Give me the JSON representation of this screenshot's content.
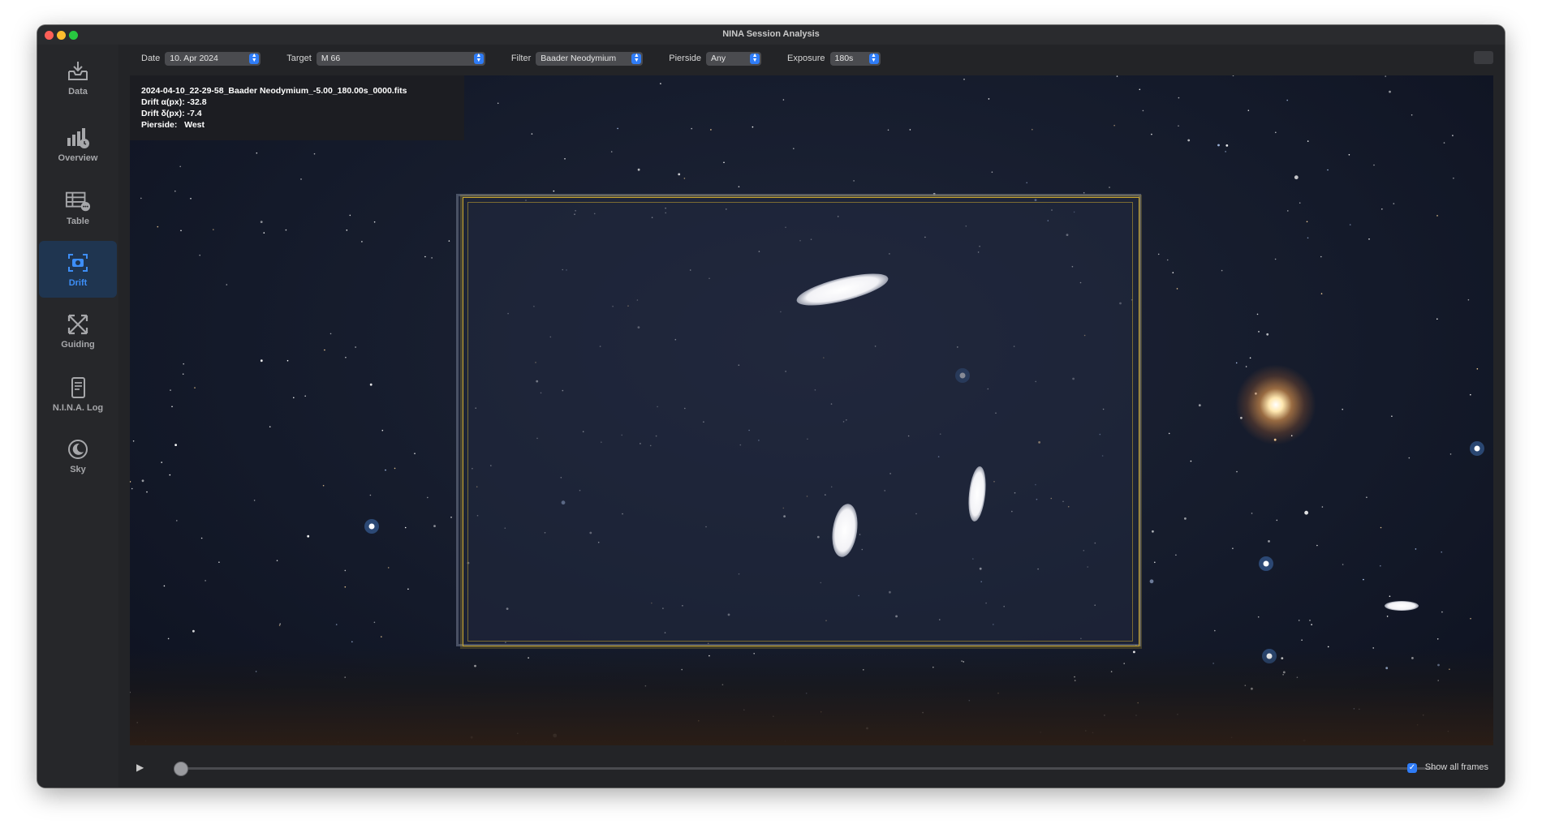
{
  "window": {
    "title": "NINA Session Analysis"
  },
  "sidebar": {
    "items": [
      {
        "label": "Data",
        "icon": "tray-download-icon",
        "active": false
      },
      {
        "label": "Overview",
        "icon": "bar-chart-icon",
        "active": false
      },
      {
        "label": "Table",
        "icon": "table-icon",
        "active": false
      },
      {
        "label": "Drift",
        "icon": "camera-viewfinder-icon",
        "active": true
      },
      {
        "label": "Guiding",
        "icon": "crosshair-arrows-icon",
        "active": false
      },
      {
        "label": "N.I.N.A. Log",
        "icon": "document-icon",
        "active": false
      },
      {
        "label": "Sky",
        "icon": "moon-icon",
        "active": false
      }
    ]
  },
  "filters": {
    "date": {
      "label": "Date",
      "value": "10. Apr 2024"
    },
    "target": {
      "label": "Target",
      "value": "M 66"
    },
    "filter": {
      "label": "Filter",
      "value": "Baader Neodymium"
    },
    "pierside": {
      "label": "Pierside",
      "value": "Any"
    },
    "exposure": {
      "label": "Exposure",
      "value": "180s"
    }
  },
  "info": {
    "filename": "2024-04-10_22-29-58_Baader Neodymium_-5.00_180.00s_0000.fits",
    "drift_ra": "Drift α(px): -32.8",
    "drift_dec": "Drift δ(px): -7.4",
    "pierside_label": "Pierside:",
    "pierside_value": "West"
  },
  "controls": {
    "play_glyph": "▶",
    "slider_position": 0.0,
    "show_all_frames_label": "Show all frames",
    "show_all_frames_checked": true
  },
  "colors": {
    "accent": "#2f7cf6",
    "active_nav_bg": "#1f3550",
    "frame_outline": "#c9a62f"
  }
}
